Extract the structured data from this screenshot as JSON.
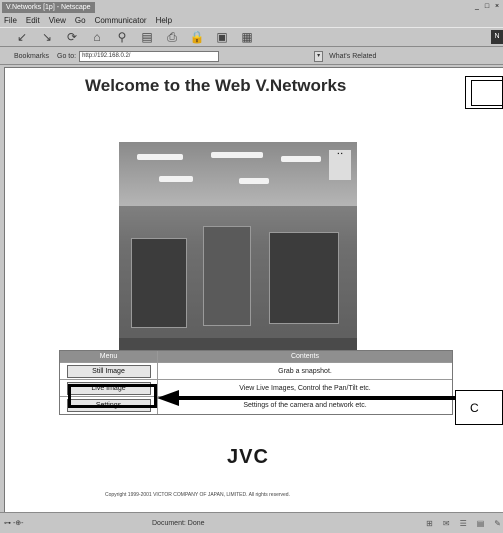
{
  "window": {
    "title": "V.Networks [1p] - Netscape",
    "controls": [
      "_",
      "□",
      "×"
    ]
  },
  "menubar": [
    "File",
    "Edit",
    "View",
    "Go",
    "Communicator",
    "Help"
  ],
  "locationbar": {
    "bookmarks_label": "Bookmarks",
    "goto_label": "Go to:",
    "url": "http://192.168.0.2/",
    "related_label": "What's Related"
  },
  "page": {
    "heading": "Welcome to the Web V.Networks",
    "table": {
      "headers": [
        "Menu",
        "Contents"
      ],
      "rows": [
        {
          "button": "Still Image",
          "description": "Grab a snapshot."
        },
        {
          "button": "Live Image",
          "description": "View Live Images, Control the Pan/Tilt etc."
        },
        {
          "button": "Settings",
          "description": "Settings of the camera and network etc."
        }
      ]
    },
    "logo": "JVC",
    "copyright": "Copyright 1999-2001 VICTOR COMPANY OF JAPAN, LIMITED. All rights reserved.",
    "callout_label": "C"
  },
  "statusbar": {
    "text": "Document: Done"
  }
}
